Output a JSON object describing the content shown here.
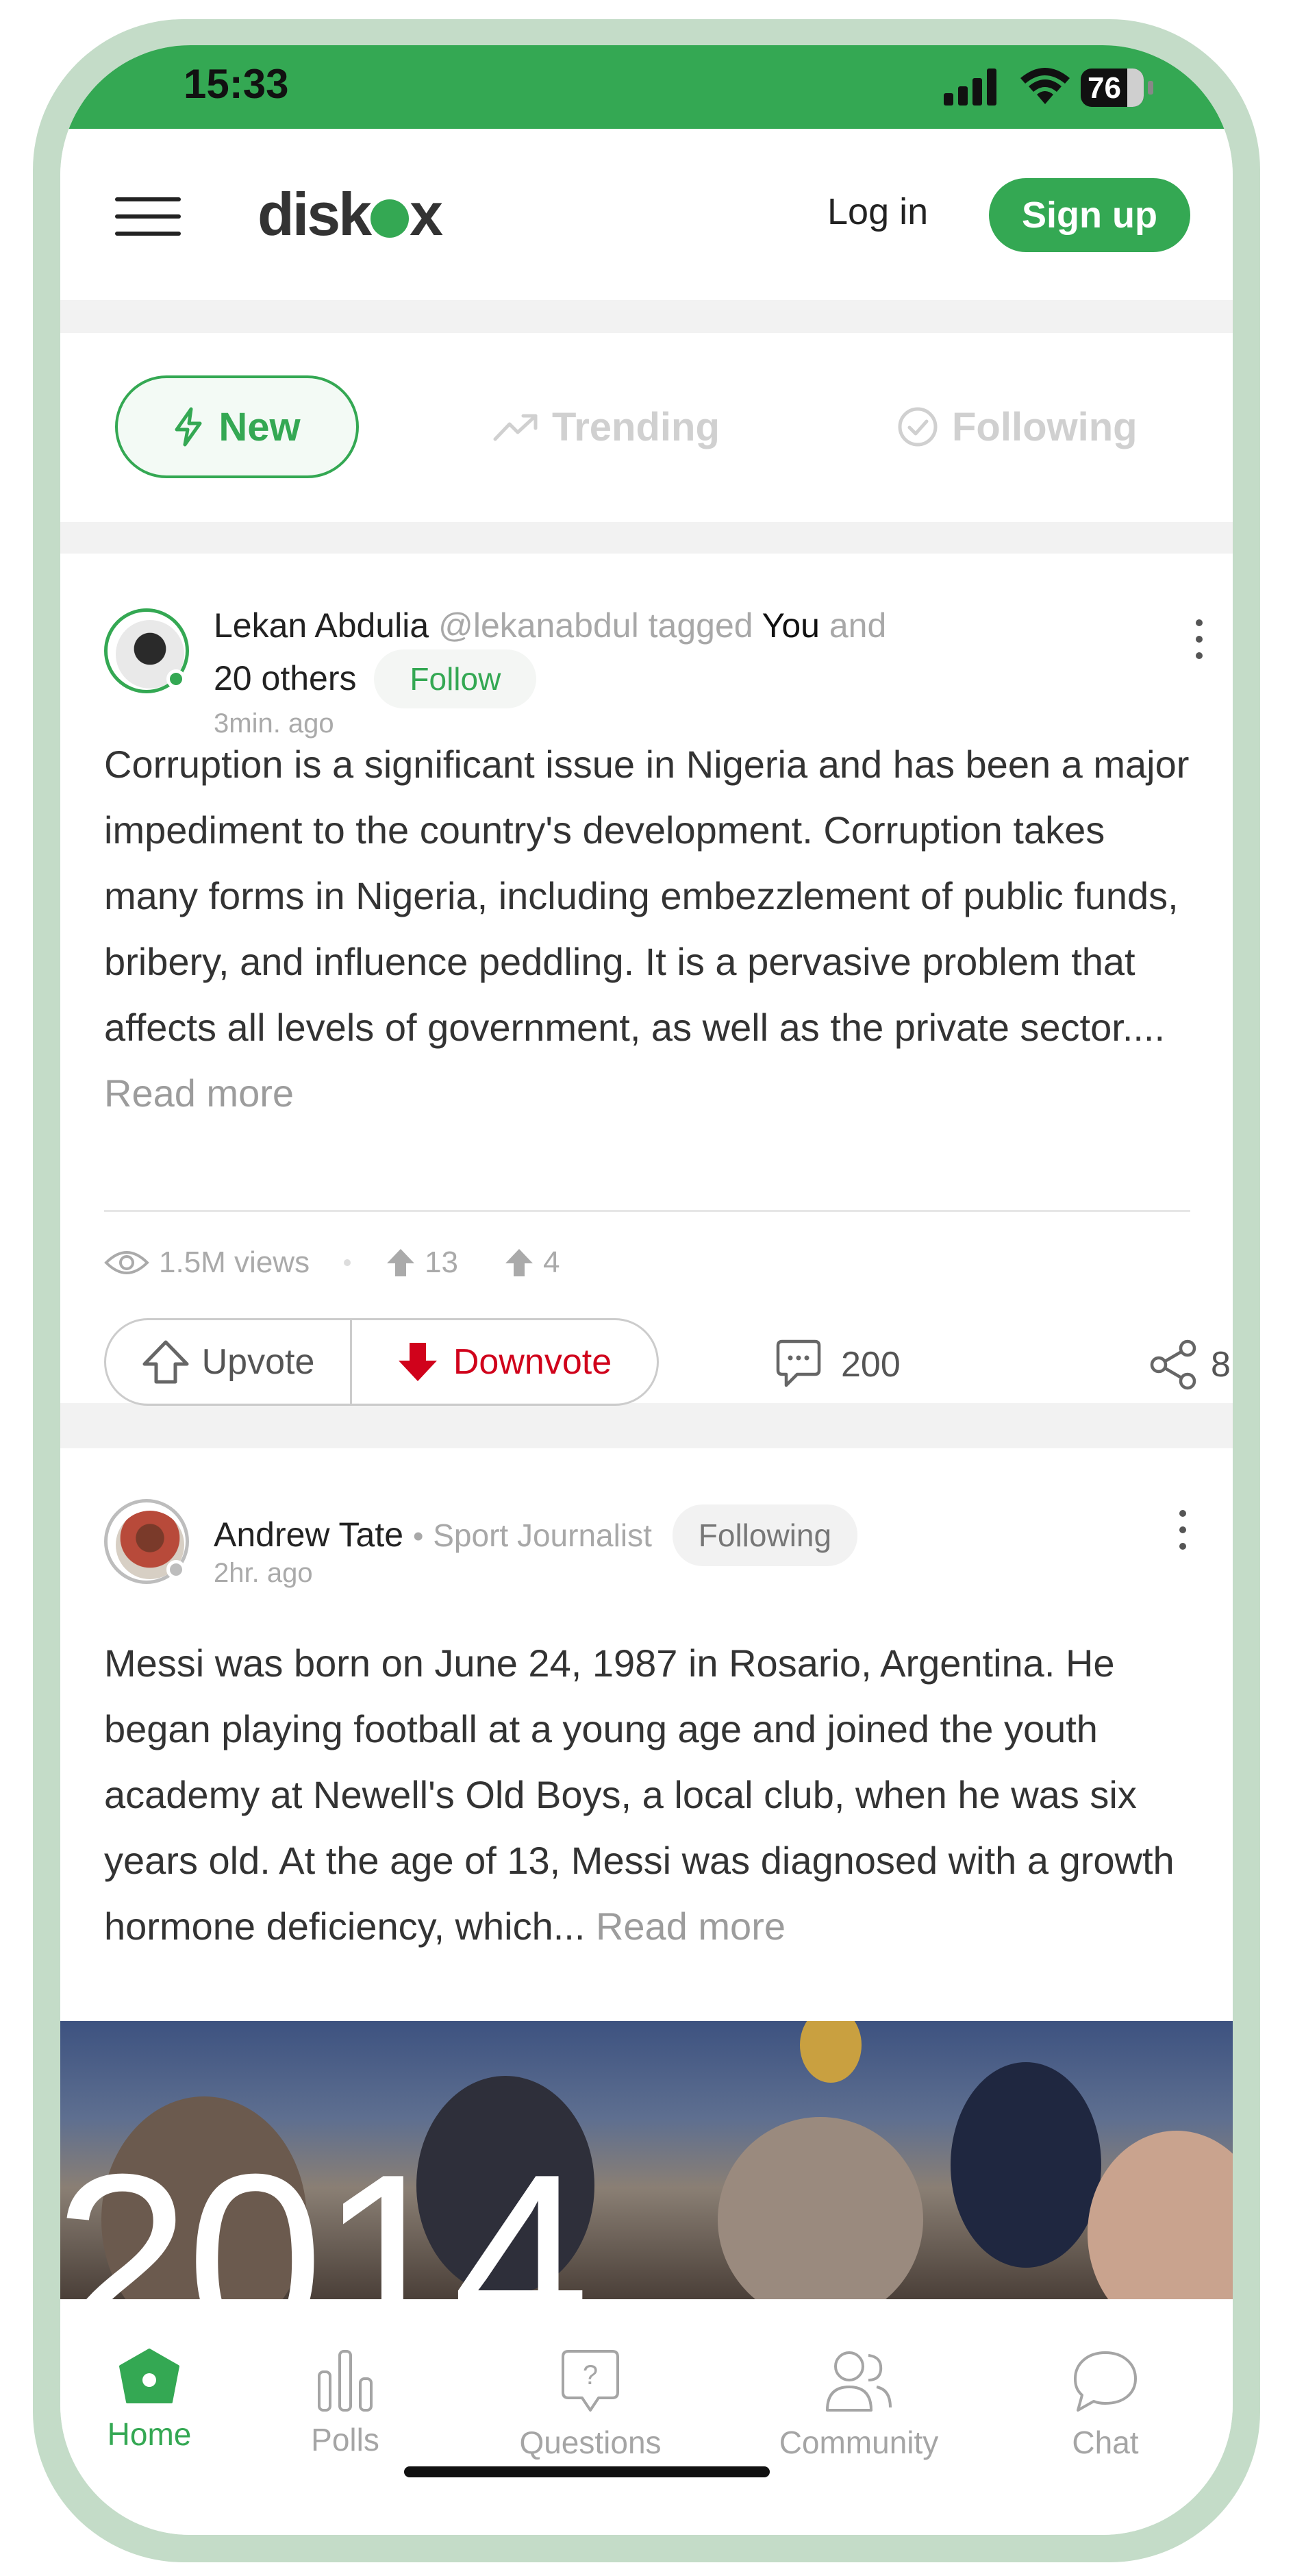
{
  "status_bar": {
    "time": "15:33",
    "battery": "76"
  },
  "header": {
    "logo": "diskox",
    "login_label": "Log in",
    "signup_label": "Sign up"
  },
  "feed_tabs": [
    {
      "label": "New",
      "icon": "lightning-icon",
      "active": true
    },
    {
      "label": "Trending",
      "icon": "trending-icon",
      "active": false
    },
    {
      "label": "Following",
      "icon": "check-circle-icon",
      "active": false
    }
  ],
  "posts": [
    {
      "author": "Lekan Abdulia",
      "handle": "@lekanabdul",
      "tagged_text": "tagged",
      "tagged_you": "You",
      "tagged_and": "and",
      "tagged_others": "20 others",
      "follow_label": "Follow",
      "time": "3min. ago",
      "body": "Corruption is a significant issue in Nigeria and has been a major impediment to the country's development. Corruption takes many forms in Nigeria, including embezzlement of public funds, bribery, and influence peddling. It is a pervasive problem that affects all levels of government, as well as the private sector....",
      "read_more": "Read more",
      "views": "1.5M views",
      "upvotes_count": "13",
      "reposts_count": "4",
      "upvote_label": "Upvote",
      "downvote_label": "Downvote",
      "comments": "200",
      "shares": "8"
    },
    {
      "author": "Andrew Tate",
      "role": "Sport Journalist",
      "following_label": "Following",
      "time": "2hr. ago",
      "body": "Messi was born on June 24, 1987 in Rosario, Argentina. He began playing football at a young age and joined the youth academy at Newell's Old Boys, a local club, when he was six years old. At the age of 13, Messi was diagnosed with a growth hormone deficiency, which...",
      "read_more": "Read more",
      "image_text": "2014"
    }
  ],
  "bottom_nav": [
    {
      "label": "Home",
      "icon": "home-icon",
      "active": true
    },
    {
      "label": "Polls",
      "icon": "polls-icon",
      "active": false
    },
    {
      "label": "Questions",
      "icon": "question-icon",
      "active": false
    },
    {
      "label": "Community",
      "icon": "community-icon",
      "active": false
    },
    {
      "label": "Chat",
      "icon": "chat-icon",
      "active": false
    }
  ],
  "colors": {
    "brand": "#34a853",
    "downvote": "#d0021b",
    "frame": "#c4dcc8"
  }
}
